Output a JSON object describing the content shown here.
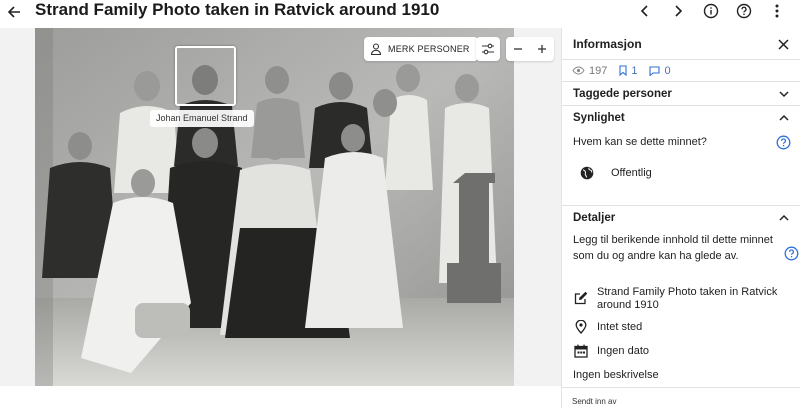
{
  "header": {
    "title": "Strand Family Photo taken in Ratvick around 1910"
  },
  "viewer": {
    "face_label": "Johan Emanuel Strand",
    "merk_button": "MERK PERSONER"
  },
  "panel": {
    "title": "Informasjon",
    "stats": {
      "views": "197",
      "saves": "1",
      "comments": "0"
    },
    "tagged": {
      "title": "Taggede personer"
    },
    "visibility": {
      "title": "Synlighet",
      "question": "Hvem kan se dette minnet?",
      "value": "Offentlig"
    },
    "details": {
      "title": "Detaljer",
      "intro": "Legg til berikende innhold til dette minnet som du og andre kan ha glede av.",
      "photo_title": "Strand Family Photo taken in Ratvick around 1910",
      "place": "Intet sted",
      "date": "Ingen dato",
      "description": "Ingen beskrivelse"
    },
    "footer": "Sendt inn av"
  },
  "colors": {
    "accent": "#2f6fd6",
    "divider": "#e3e3e3",
    "viewer_bg": "#f2f2f2"
  }
}
